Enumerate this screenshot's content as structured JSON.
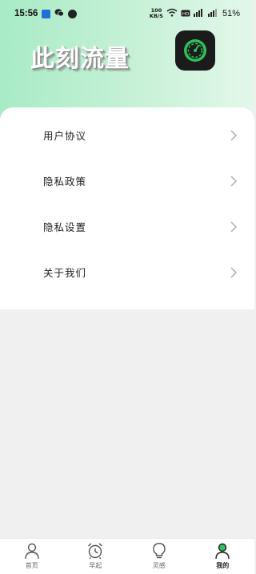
{
  "status_bar": {
    "time": "15:56",
    "net_speed_value": "100",
    "net_speed_unit": "KB/S",
    "battery": "51%"
  },
  "header": {
    "title": "此刻流量"
  },
  "menu": {
    "items": [
      {
        "label": "用户协议"
      },
      {
        "label": "隐私政策"
      },
      {
        "label": "隐私设置"
      },
      {
        "label": "关于我们"
      }
    ]
  },
  "tabbar": {
    "tabs": [
      {
        "label": "首页",
        "active": false
      },
      {
        "label": "早起",
        "active": false
      },
      {
        "label": "灵感",
        "active": false
      },
      {
        "label": "我的",
        "active": true
      }
    ]
  },
  "colors": {
    "header_gradient_start": "#a8ebc6",
    "accent_green": "#2fbf5a",
    "logo_bg": "#1b1b1b"
  }
}
